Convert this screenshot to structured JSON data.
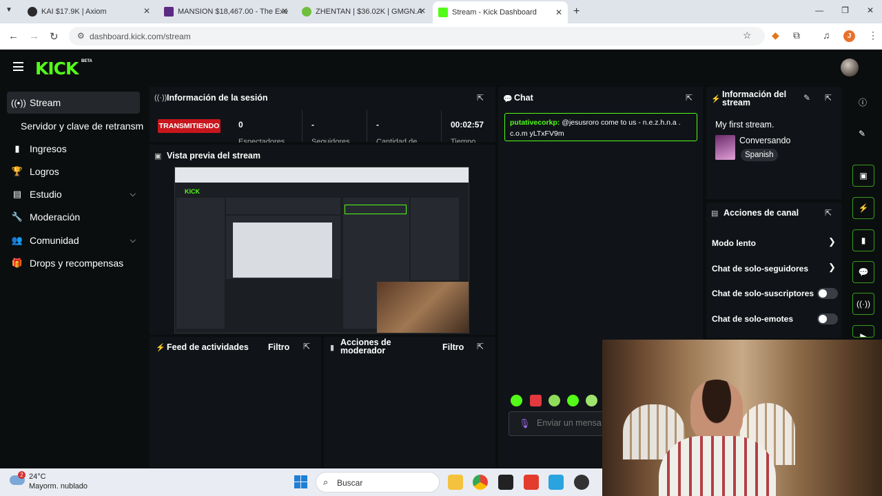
{
  "browser": {
    "tabs": [
      {
        "label": "KAI $17.9K | Axiom",
        "color": "#2b2b2b"
      },
      {
        "label": "MANSION $18,467.00 - The Exe",
        "color": "#5b2b82"
      },
      {
        "label": "ZHENTAN | $36.02K | GMGN.A",
        "color": "#6fbf3c"
      },
      {
        "label": "Stream - Kick Dashboard",
        "color": "#53fc18"
      }
    ],
    "url": "dashboard.kick.com/stream",
    "profile_initial": "J"
  },
  "kick": {
    "logo": "KICK",
    "beta": "BETA"
  },
  "sidebar": {
    "items": [
      {
        "label": "Stream",
        "icon": "broadcast-icon"
      },
      {
        "label": "Servidor y clave de retransm",
        "icon": ""
      },
      {
        "label": "Ingresos",
        "icon": "bars-icon"
      },
      {
        "label": "Logros",
        "icon": "trophy-icon"
      },
      {
        "label": "Estudio",
        "icon": "chart-icon"
      },
      {
        "label": "Moderación",
        "icon": "wrench-icon"
      },
      {
        "label": "Comunidad",
        "icon": "people-icon"
      },
      {
        "label": "Drops y recompensas",
        "icon": "gift-icon"
      }
    ]
  },
  "session": {
    "title": "Información de la sesión",
    "status": "TRANSMITIENDO",
    "stats": [
      {
        "value": "0",
        "label": "Espectadores"
      },
      {
        "value": "-",
        "label": "Seguidores"
      },
      {
        "value": "-",
        "label": "Cantidad de"
      },
      {
        "value": "00:02:57",
        "label": "Tiempo"
      }
    ]
  },
  "preview": {
    "title": "Vista previa del stream"
  },
  "activity": {
    "title": "Feed de actividades",
    "filter": "Filtro"
  },
  "modactions": {
    "title": "Acciones de moderador",
    "filter": "Filtro"
  },
  "chat": {
    "title": "Chat",
    "message_user": "putativecorkp:",
    "message_text": "@jesusroro come to us - n.e.z.h.n.a . c.o.m yLTxFV9m",
    "input_placeholder": "Enviar un mensa"
  },
  "stream_info": {
    "title": "Información del stream",
    "stream_title": "My first stream.",
    "category": "Conversando",
    "language": "Spanish"
  },
  "channel_actions": {
    "title": "Acciones de canal",
    "rows": [
      {
        "label": "Modo lento",
        "type": "arrow"
      },
      {
        "label": "Chat de solo-seguidores",
        "type": "arrow"
      },
      {
        "label": "Chat de solo-suscriptores",
        "type": "toggle",
        "on": false
      },
      {
        "label": "Chat de solo-emotes",
        "type": "toggle",
        "on": false
      }
    ]
  },
  "taskbar": {
    "temperature": "24°C",
    "weather": "Mayorm. nublado",
    "weather_badge": "2",
    "search": "Buscar"
  }
}
